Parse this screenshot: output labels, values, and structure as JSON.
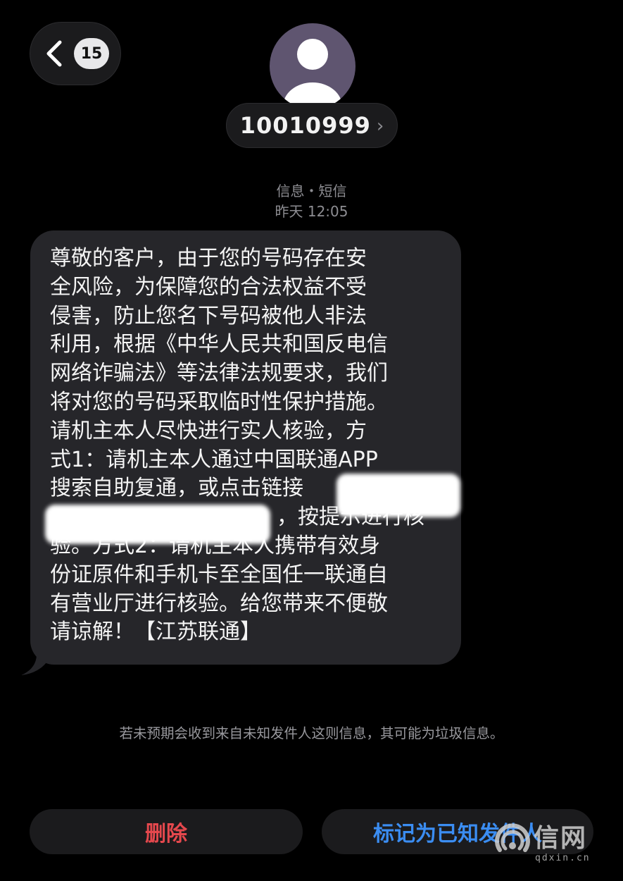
{
  "header": {
    "unread_count": "15",
    "contact_number": "10010999",
    "contact_chevron": "›"
  },
  "meta": {
    "message_type": "信息・短信",
    "timestamp": "昨天 12:05"
  },
  "message": {
    "lines": [
      "尊敬的客户，由于您的号码存在安",
      "全风险，为保障您的合法权益不受",
      "侵害，防止您名下号码被他人非法",
      "利用，根据《中华人民共和国反电信",
      "网络诈骗法》等法律法规要求，我们",
      "将对您的号码采取临时性保护措施。",
      "请机主本人尽快进行实人核验，方",
      "式1：请机主本人通过中国联通APP",
      "搜索自助复通，或点击链接",
      "，按提示进行核",
      "验。方式2：请机主本人携带有效身",
      "份证原件和手机卡至全国任一联通自",
      "有营业厅进行核验。给您带来不便敬",
      "请谅解！【江苏联通】"
    ]
  },
  "notice": {
    "text": "若未预期会收到来自未知发件人这则信息，其可能为垃圾信息。"
  },
  "actions": {
    "delete_label": "删除",
    "mark_known_label": "标记为已知发件人"
  },
  "watermark": {
    "text": "信网",
    "sub": "qdxin.cn"
  },
  "colors": {
    "background": "#000000",
    "bubble": "#26262a",
    "delete": "#e5484d",
    "accent": "#3b8df2",
    "secondary_text": "#8d8d92"
  }
}
